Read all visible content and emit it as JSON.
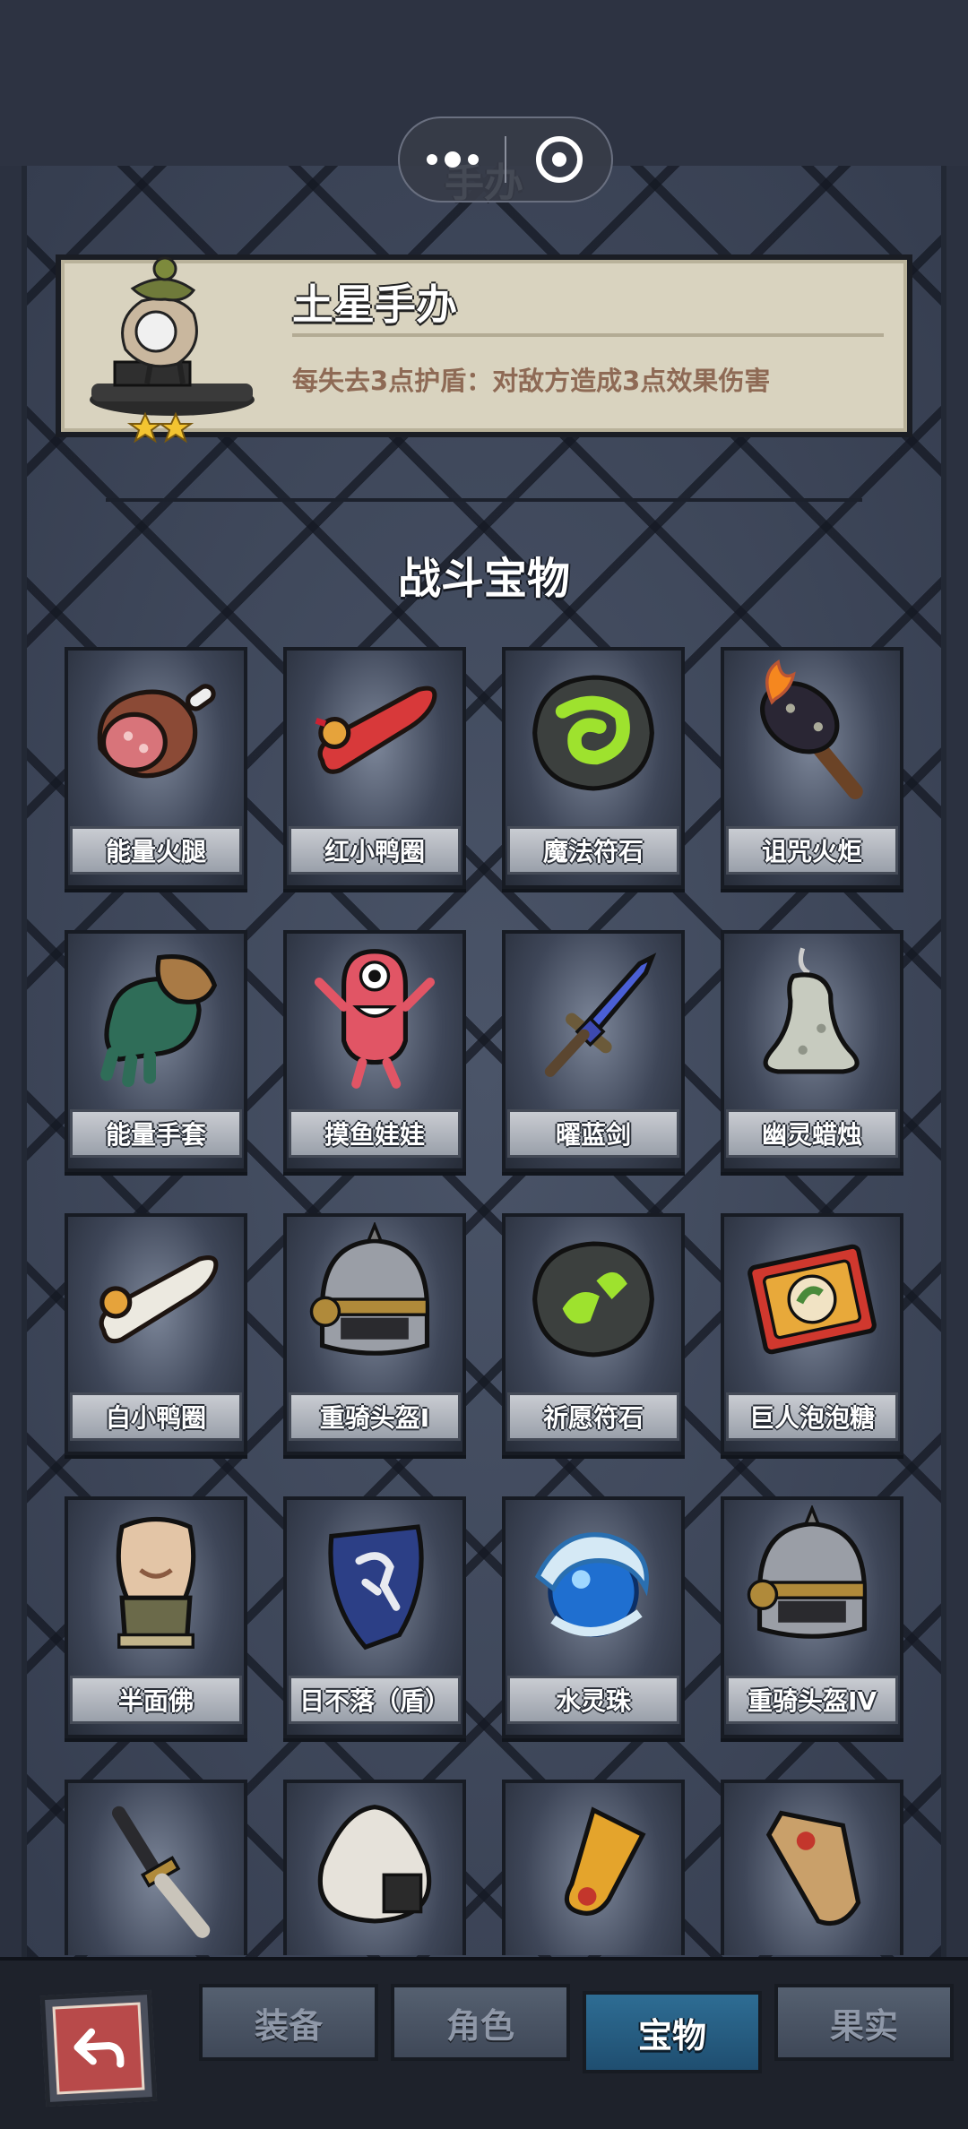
{
  "header": {
    "title": "手办"
  },
  "featured": {
    "name": "土星手办",
    "description": "每失去3点护盾：对敌方造成3点效果伤害",
    "stars": 2
  },
  "section": {
    "title": "战斗宝物"
  },
  "items": [
    {
      "label": "能量火腿",
      "icon": "ham-icon"
    },
    {
      "label": "红小鸭圈",
      "icon": "red-duck-ring-icon"
    },
    {
      "label": "魔法符石",
      "icon": "magic-rune-stone-icon"
    },
    {
      "label": "诅咒火炬",
      "icon": "cursed-torch-icon"
    },
    {
      "label": "能量手套",
      "icon": "power-glove-icon"
    },
    {
      "label": "摸鱼娃娃",
      "icon": "slacker-doll-icon"
    },
    {
      "label": "曜蓝剑",
      "icon": "blue-sword-icon"
    },
    {
      "label": "幽灵蜡烛",
      "icon": "ghost-candle-icon"
    },
    {
      "label": "白小鸭圈",
      "icon": "white-duck-ring-icon"
    },
    {
      "label": "重骑头盔I",
      "icon": "knight-helmet-icon"
    },
    {
      "label": "祈愿符石",
      "icon": "wish-rune-stone-icon"
    },
    {
      "label": "巨人泡泡糖",
      "icon": "giant-bubblegum-icon"
    },
    {
      "label": "半面佛",
      "icon": "half-buddha-icon"
    },
    {
      "label": "日不落（盾）",
      "icon": "sun-shield-icon"
    },
    {
      "label": "水灵珠",
      "icon": "water-orb-icon"
    },
    {
      "label": "重骑头盔IV",
      "icon": "knight-helmet-icon"
    },
    {
      "label": "",
      "icon": "dagger-icon"
    },
    {
      "label": "",
      "icon": "rice-ball-icon"
    },
    {
      "label": "",
      "icon": "golden-horn-icon"
    },
    {
      "label": "",
      "icon": "scroll-icon"
    }
  ],
  "tabs": [
    {
      "label": "装备",
      "active": false
    },
    {
      "label": "角色",
      "active": false
    },
    {
      "label": "宝物",
      "active": true
    },
    {
      "label": "果实",
      "active": false
    }
  ],
  "colors": {
    "background": "#3b4457",
    "featured_card": "#d9d3bf",
    "description_text": "#8e6a55",
    "active_tab": "#2e6d94",
    "back_button": "#b84a4a"
  }
}
